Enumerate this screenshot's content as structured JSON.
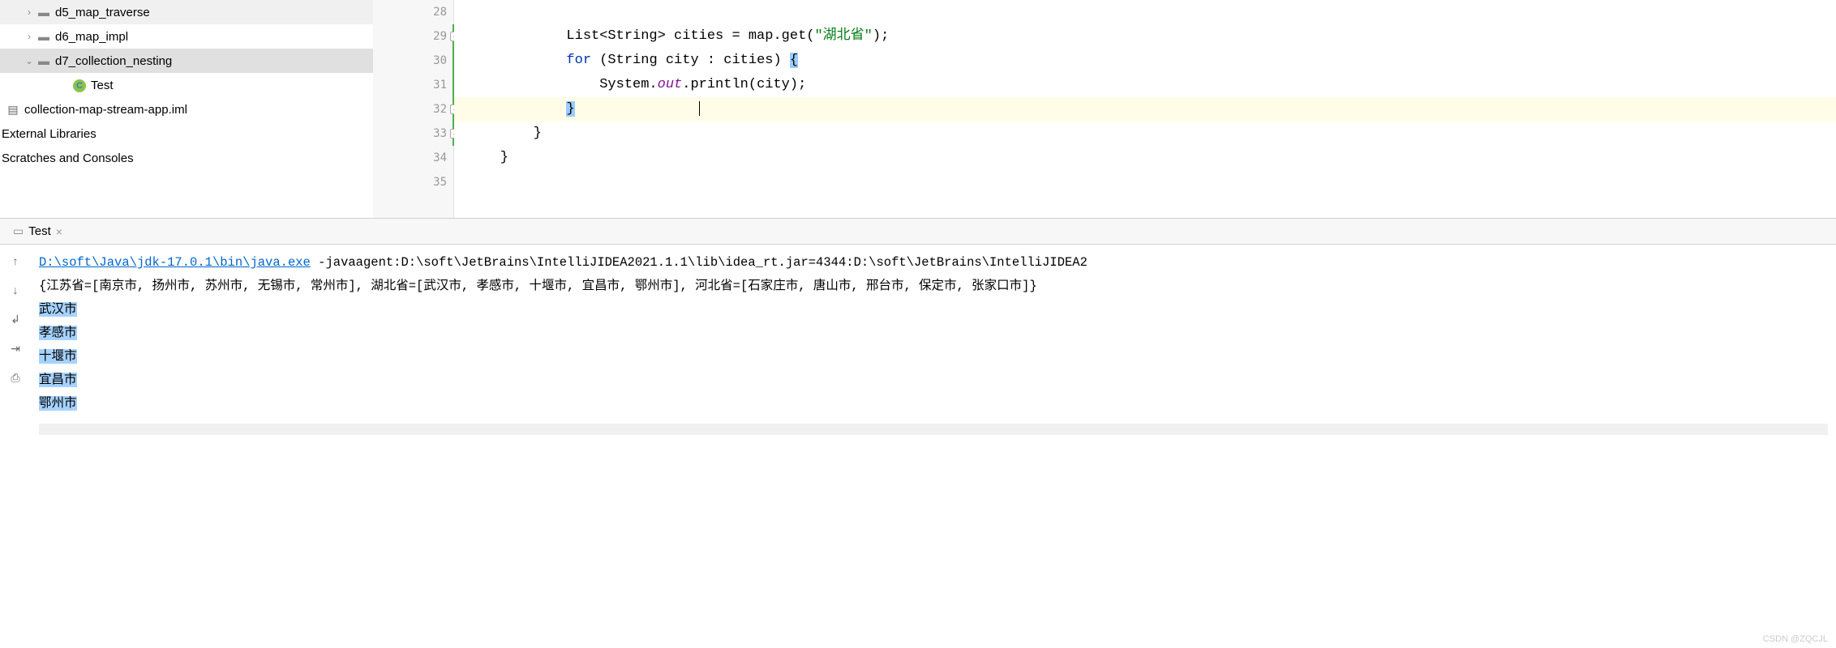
{
  "tree": {
    "items": [
      {
        "indent": 28,
        "arrow": "›",
        "icon": "folder",
        "label": "d5_map_traverse",
        "selected": false
      },
      {
        "indent": 28,
        "arrow": "›",
        "icon": "folder",
        "label": "d6_map_impl",
        "selected": false
      },
      {
        "indent": 28,
        "arrow": "⌄",
        "icon": "folder",
        "label": "d7_collection_nesting",
        "selected": true
      },
      {
        "indent": 88,
        "arrow": "",
        "icon": "class",
        "label": "Test",
        "selected": false
      }
    ],
    "iml_file": "collection-map-stream-app.iml",
    "external_libraries": "External Libraries",
    "scratches": "Scratches and Consoles"
  },
  "editor": {
    "line_numbers": [
      "28",
      "29",
      "30",
      "31",
      "32",
      "33",
      "34",
      "35"
    ],
    "code": {
      "l29_pre": "            List<String> cities = map.get(",
      "l29_str": "\"湖北省\"",
      "l29_post": ");",
      "l30_kw": "for",
      "l30_rest": " (String city : cities) ",
      "l30_brace": "{",
      "l31_pre": "                System.",
      "l31_field": "out",
      "l31_post": ".println(city);",
      "l32_brace": "}",
      "l33": "        }",
      "l34": "    }"
    }
  },
  "run_tab": {
    "label": "Test"
  },
  "console": {
    "exe_path": "D:\\soft\\Java\\jdk-17.0.1\\bin\\java.exe",
    "exe_args": " -javaagent:D:\\soft\\JetBrains\\IntelliJIDEA2021.1.1\\lib\\idea_rt.jar=4344:D:\\soft\\JetBrains\\IntelliJIDEA2",
    "map_output": "{江苏省=[南京市, 扬州市, 苏州市, 无锡市, 常州市], 湖北省=[武汉市, 孝感市, 十堰市, 宜昌市, 鄂州市], 河北省=[石家庄市, 唐山市, 邢台市, 保定市, 张家口市]}",
    "cities": [
      "武汉市",
      "孝感市",
      "十堰市",
      "宜昌市",
      "鄂州市"
    ]
  },
  "watermark": "CSDN @ZQCJL"
}
